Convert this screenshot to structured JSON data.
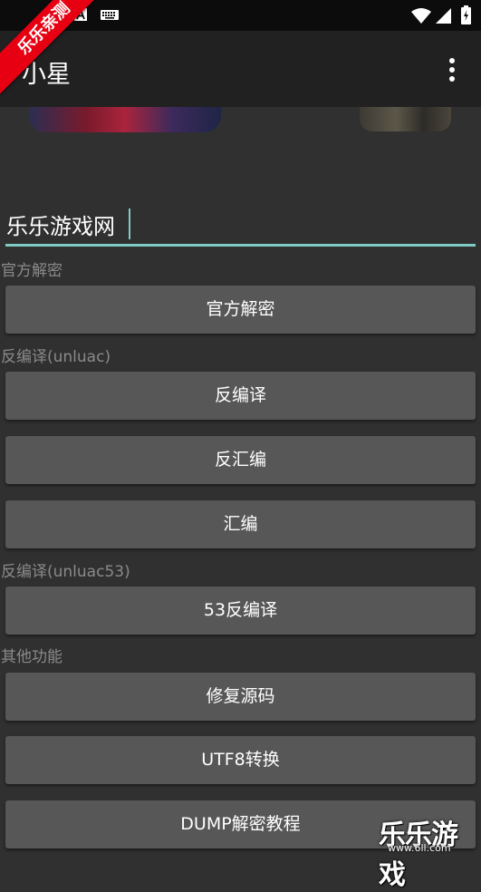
{
  "app": {
    "title": "小星",
    "more_icon": "more-vert-icon"
  },
  "badge": {
    "text": "乐乐亲测"
  },
  "input": {
    "value": "乐乐游戏网"
  },
  "sections": [
    {
      "label": "官方解密",
      "buttons": [
        "官方解密"
      ]
    },
    {
      "label": "反编译(unluac)",
      "buttons": [
        "反编译",
        "反汇编",
        "汇编"
      ]
    },
    {
      "label": "反编译(unluac53)",
      "buttons": [
        "53反编译"
      ]
    },
    {
      "label": "其他功能",
      "buttons": [
        "修复源码",
        "UTF8转换",
        "DUMP解密教程"
      ]
    }
  ],
  "watermark": {
    "text": "乐乐游戏",
    "url": "www.6ll.com"
  },
  "colors": {
    "accent": "#80cbc4",
    "appbar": "#212121",
    "background": "#303030",
    "button": "#575757",
    "badge": "#e60012"
  }
}
